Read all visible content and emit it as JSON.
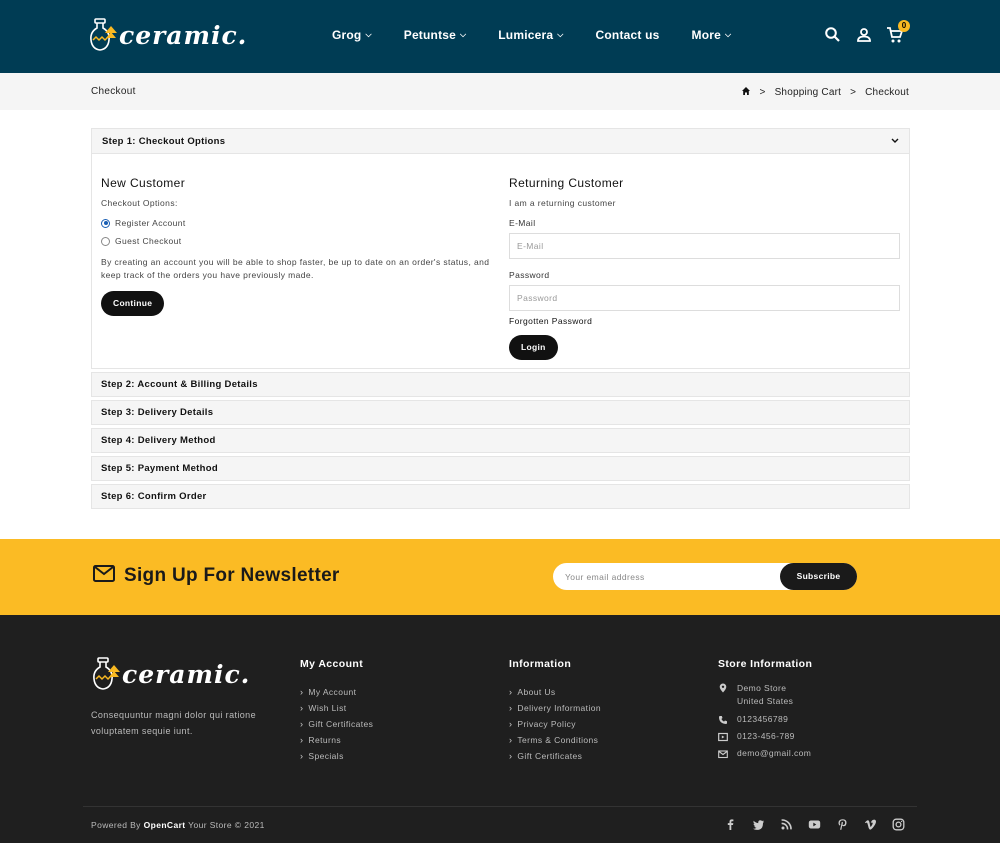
{
  "header": {
    "logo_text": "ceramic.",
    "nav": [
      {
        "label": "Grog"
      },
      {
        "label": "Petuntse"
      },
      {
        "label": "Lumicera"
      },
      {
        "label": "Contact us"
      },
      {
        "label": "More"
      }
    ],
    "cart_count": "0"
  },
  "breadcrumb": {
    "page_title": "Checkout",
    "items": [
      "Shopping Cart",
      "Checkout"
    ]
  },
  "checkout": {
    "step1_title": "Step 1: Checkout Options",
    "new_customer": {
      "heading": "New Customer",
      "options_label": "Checkout Options:",
      "option_register": "Register Account",
      "option_guest": "Guest Checkout",
      "selected": "register",
      "description": "By creating an account you will be able to shop faster, be up to date on an order's status, and keep track of the orders you have previously made.",
      "continue_label": "Continue"
    },
    "returning_customer": {
      "heading": "Returning Customer",
      "subtitle": "I am a returning customer",
      "email_label": "E-Mail",
      "email_placeholder": "E-Mail",
      "password_label": "Password",
      "password_placeholder": "Password",
      "forgot_label": "Forgotten Password",
      "login_label": "Login"
    },
    "steps": [
      "Step 2: Account & Billing Details",
      "Step 3: Delivery Details",
      "Step 4: Delivery Method",
      "Step 5: Payment Method",
      "Step 6: Confirm Order"
    ]
  },
  "newsletter": {
    "title": "Sign Up For Newsletter",
    "placeholder": "Your email address",
    "button": "Subscribe"
  },
  "footer": {
    "logo_text": "ceramic.",
    "description": "Consequuntur magni dolor qui ratione voluptatem sequie iunt.",
    "my_account": {
      "title": "My Account",
      "links": [
        "My Account",
        "Wish List",
        "Gift Certificates",
        "Returns",
        "Specials"
      ]
    },
    "information": {
      "title": "Information",
      "links": [
        "About Us",
        "Delivery Information",
        "Privacy Policy",
        "Terms & Conditions",
        "Gift Certificates"
      ]
    },
    "store": {
      "title": "Store Information",
      "address_line1": "Demo Store",
      "address_line2": "United States",
      "phone": "0123456789",
      "fax": "0123-456-789",
      "email": "demo@gmail.com"
    },
    "powered_prefix": "Powered By",
    "powered_brand": "OpenCart",
    "powered_suffix": "Your Store © 2021",
    "social_icons": [
      "facebook-icon",
      "twitter-icon",
      "rss-icon",
      "youtube-icon",
      "pinterest-icon",
      "vimeo-icon",
      "instagram-icon"
    ]
  },
  "colors": {
    "header_bg": "#003c54",
    "accent_yellow": "#fbbb24",
    "footer_bg": "#1f1f1f",
    "button_dark": "#111111",
    "radio_blue": "#1a5fb4"
  }
}
